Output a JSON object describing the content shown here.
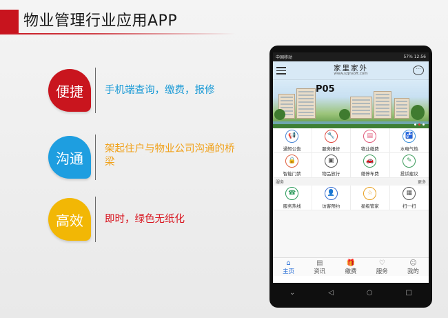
{
  "header": {
    "title": "物业管理行业应用APP",
    "accent": "#c8141e"
  },
  "features": [
    {
      "badge": "便捷",
      "text": "手机端查询，缴费，报修",
      "color": "#c9151e",
      "text_color": "#1a9ad6"
    },
    {
      "badge": "沟通",
      "text": "架起住户与物业公司沟通的桥梁",
      "color": "#1e9ee0",
      "text_color": "#f0a11a"
    },
    {
      "badge": "高效",
      "text": "即时，绿色无纸化",
      "color": "#f2b705",
      "text_color": "#d8141e"
    }
  ],
  "phone": {
    "status_left": "中国移动",
    "status_right": "57% 12:56",
    "app_title": "家里家外",
    "app_subtitle": "www.szjnsoft.com",
    "banner_label": "P05",
    "grid_items": [
      {
        "label": "通知公告",
        "icon": "megaphone-icon",
        "glyph": "📢",
        "color": "#4a86d4"
      },
      {
        "label": "服务报修",
        "icon": "wrench-icon",
        "glyph": "🔧",
        "color": "#e0473e"
      },
      {
        "label": "物业缴费",
        "icon": "bill-icon",
        "glyph": "▤",
        "color": "#e05a7a"
      },
      {
        "label": "水电气热",
        "icon": "faucet-icon",
        "glyph": "🚰",
        "color": "#3a8fd8"
      },
      {
        "label": "智能门禁",
        "icon": "lock-icon",
        "glyph": "🔒",
        "color": "#e06040"
      },
      {
        "label": "物品放行",
        "icon": "package-icon",
        "glyph": "▣",
        "color": "#555555"
      },
      {
        "label": "缴停车费",
        "icon": "car-icon",
        "glyph": "🚗",
        "color": "#3a9a5a"
      },
      {
        "label": "投诉建议",
        "icon": "pencil-icon",
        "glyph": "✎",
        "color": "#3a9a5a"
      }
    ],
    "section_label": "服务",
    "section_more": "更多",
    "service_items": [
      {
        "label": "服务热线",
        "icon": "phone-icon",
        "glyph": "☎",
        "color": "#2a9a5a"
      },
      {
        "label": "访客预约",
        "icon": "visitor-icon",
        "glyph": "👤",
        "color": "#3a6fd0"
      },
      {
        "label": "星级管家",
        "icon": "star-icon",
        "glyph": "☆",
        "color": "#e8a020"
      },
      {
        "label": "扫一扫",
        "icon": "qr-icon",
        "glyph": "▦",
        "color": "#555555"
      }
    ],
    "tabs": [
      {
        "label": "主页",
        "icon": "home-icon",
        "glyph": "⌂",
        "active": true
      },
      {
        "label": "资讯",
        "icon": "news-icon",
        "glyph": "▤",
        "active": false
      },
      {
        "label": "缴费",
        "icon": "gift-icon",
        "glyph": "🎁",
        "active": false
      },
      {
        "label": "服务",
        "icon": "heart-icon",
        "glyph": "♡",
        "active": false
      },
      {
        "label": "我的",
        "icon": "user-icon",
        "glyph": "☺",
        "active": false
      }
    ]
  }
}
